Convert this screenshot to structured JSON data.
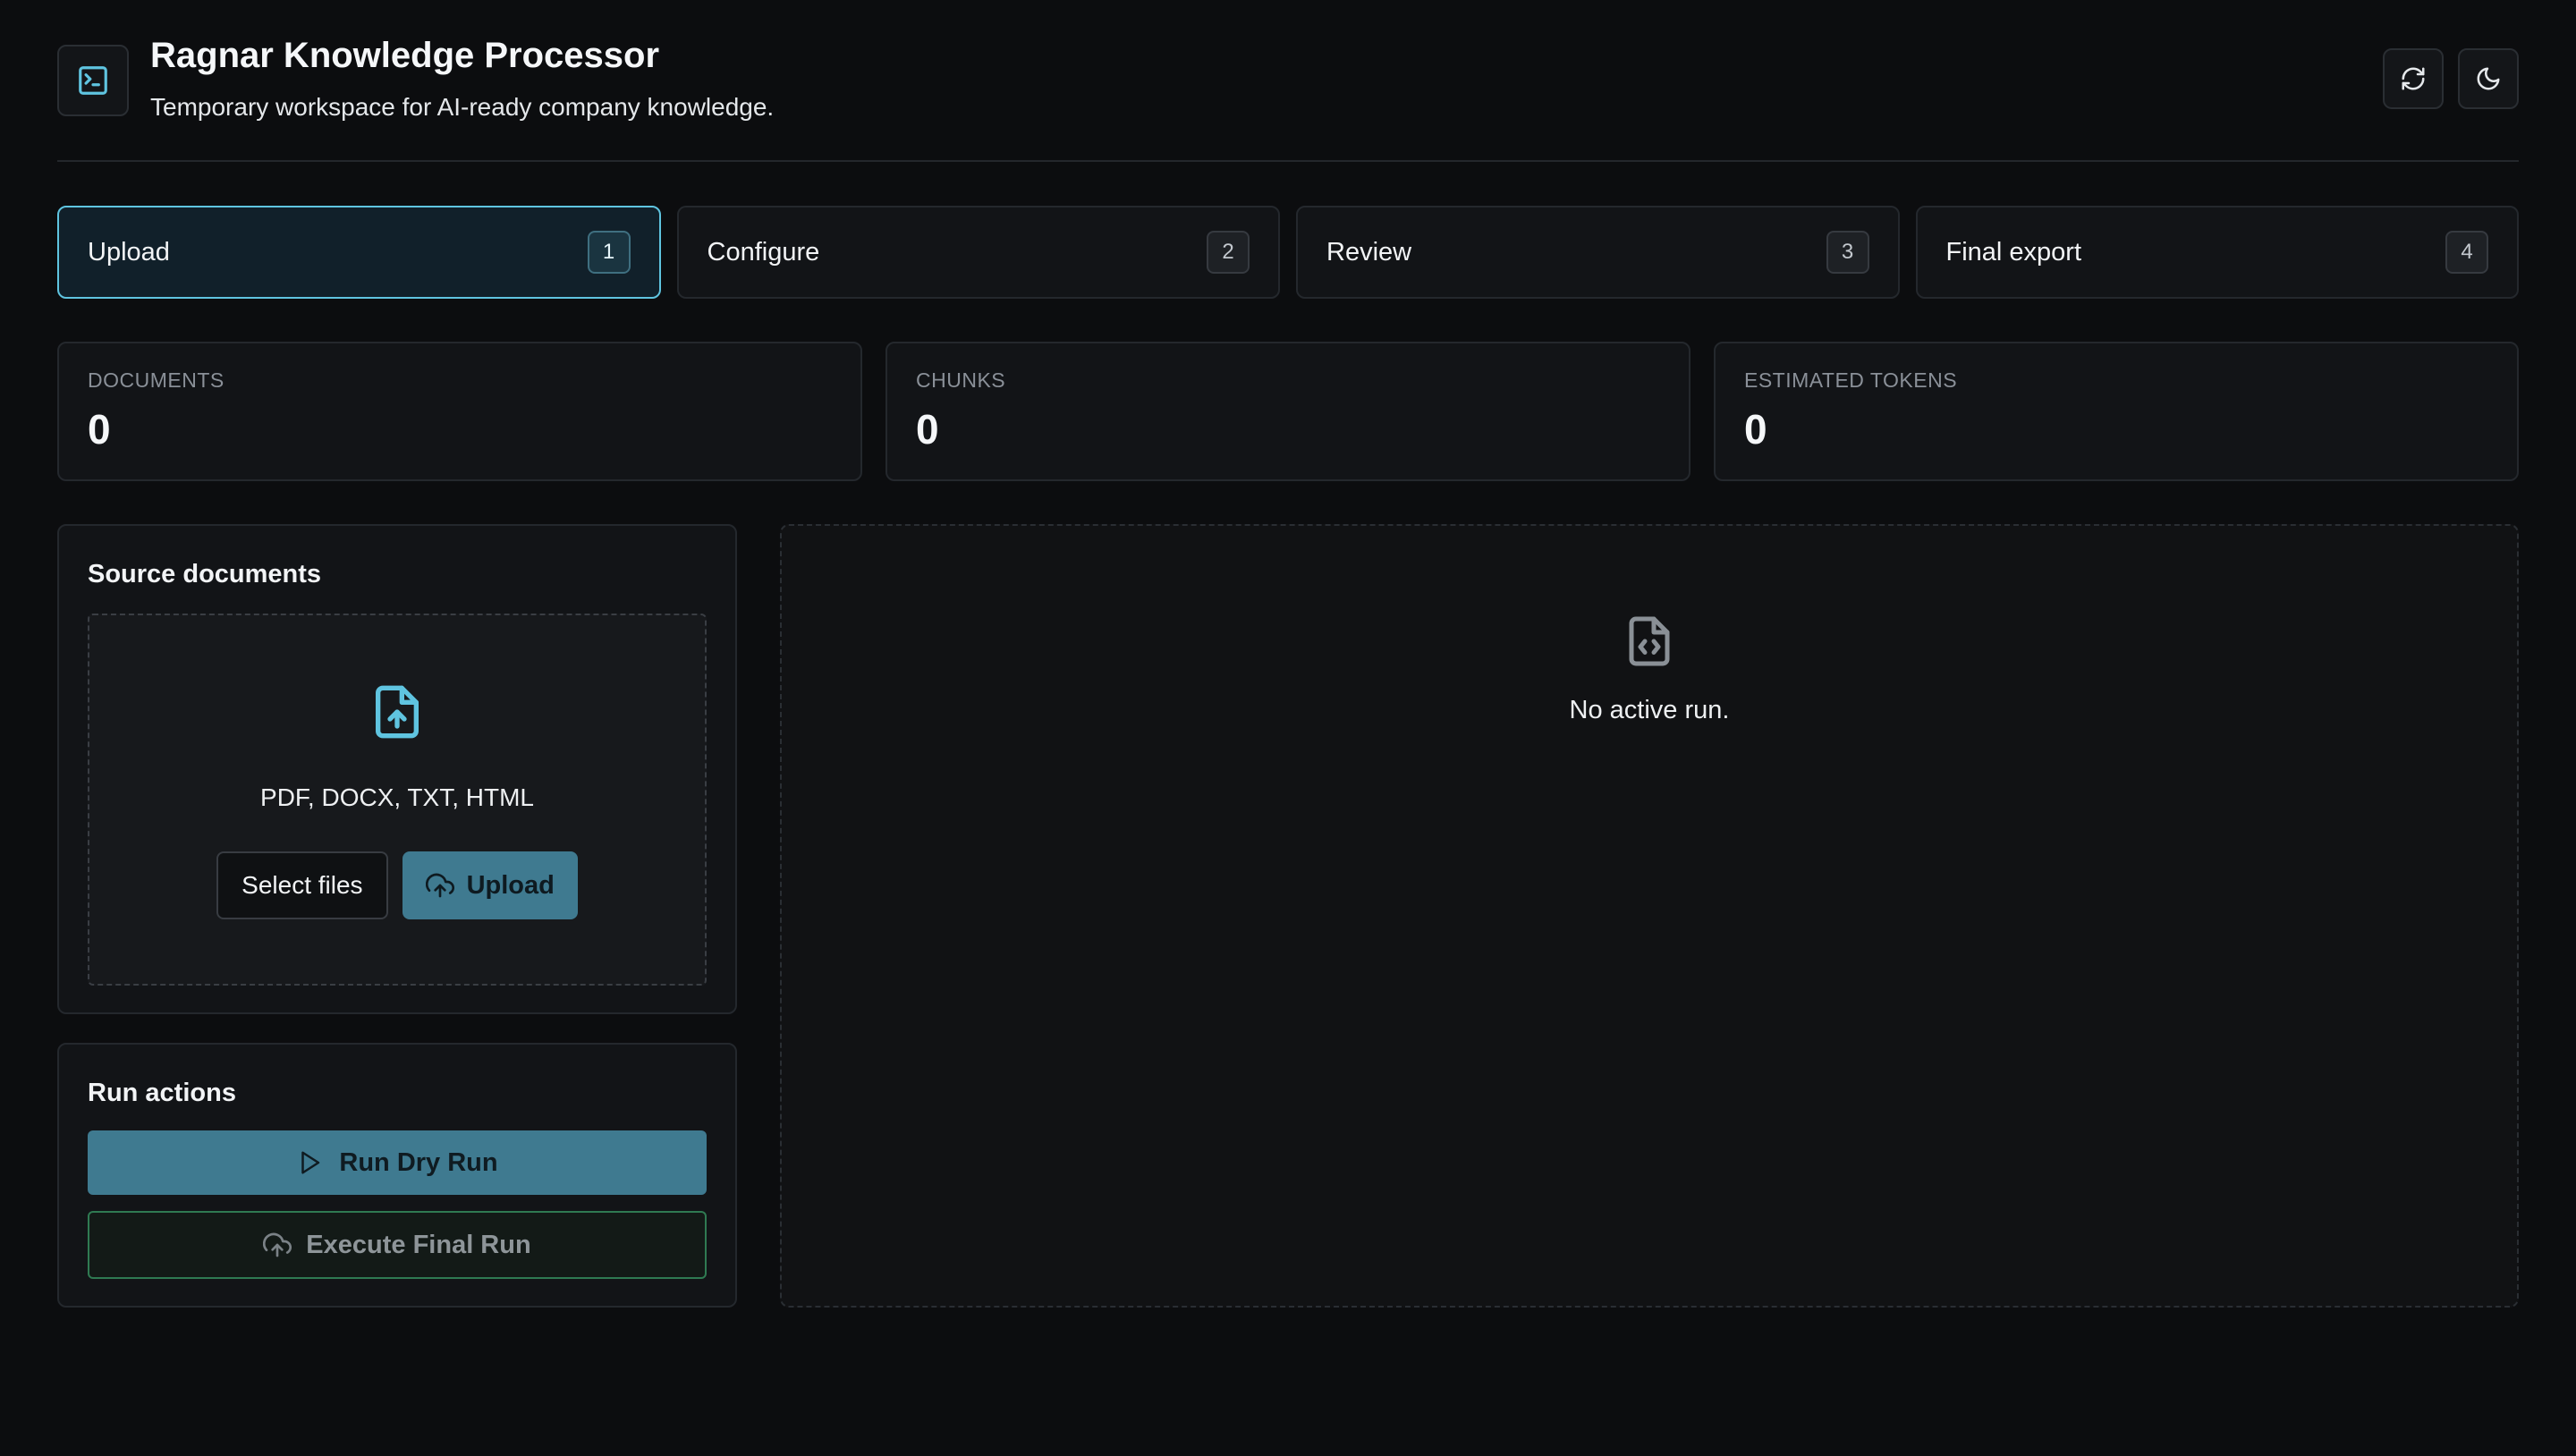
{
  "header": {
    "title": "Ragnar Knowledge Processor",
    "subtitle": "Temporary workspace for AI-ready company knowledge.",
    "logo_icon": "terminal-icon",
    "actions": [
      {
        "icon": "refresh-icon"
      },
      {
        "icon": "moon-icon"
      }
    ]
  },
  "steps": [
    {
      "label": "Upload",
      "number": "1",
      "active": true
    },
    {
      "label": "Configure",
      "number": "2",
      "active": false
    },
    {
      "label": "Review",
      "number": "3",
      "active": false
    },
    {
      "label": "Final export",
      "number": "4",
      "active": false
    }
  ],
  "stats": [
    {
      "label": "DOCUMENTS",
      "value": "0"
    },
    {
      "label": "CHUNKS",
      "value": "0"
    },
    {
      "label": "ESTIMATED TOKENS",
      "value": "0"
    }
  ],
  "source": {
    "title": "Source documents",
    "formats": "PDF, DOCX, TXT, HTML",
    "select_label": "Select files",
    "upload_label": "Upload"
  },
  "run_actions": {
    "title": "Run actions",
    "dry_run_label": "Run Dry Run",
    "final_run_label": "Execute Final Run"
  },
  "run_view": {
    "empty_text": "No active run."
  },
  "colors": {
    "accent": "#5fc4e0",
    "primary_button": "#3f7a90",
    "final_run_border": "#2f7a52",
    "background": "#0c0d0f",
    "panel": "#121417"
  }
}
